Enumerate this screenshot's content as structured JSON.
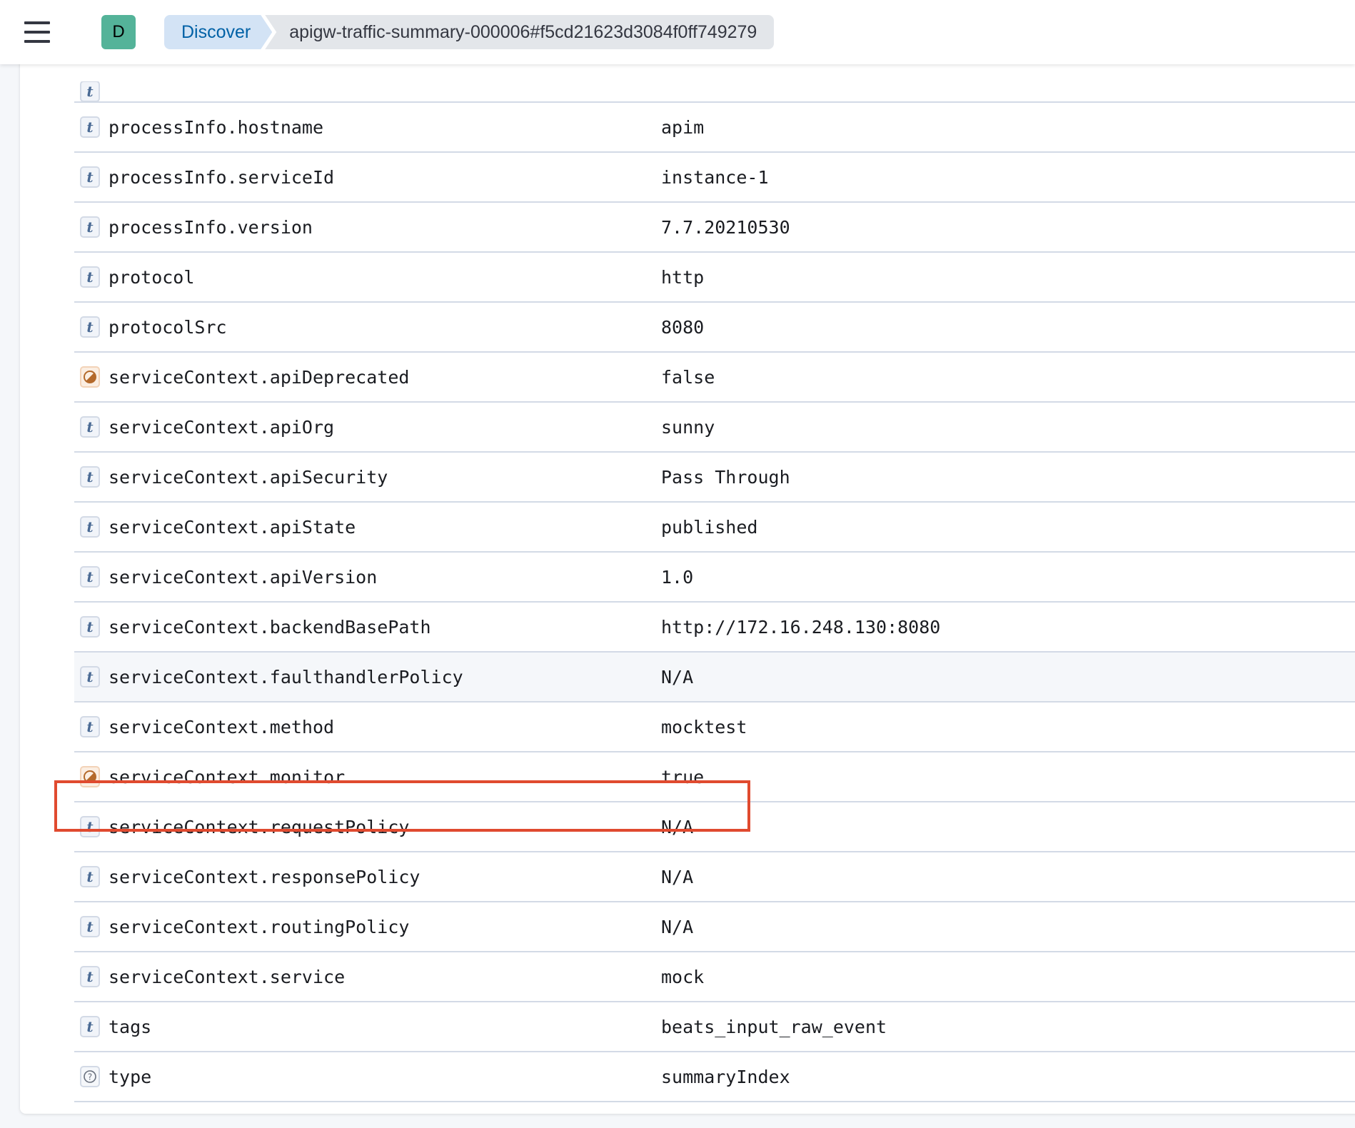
{
  "header": {
    "space_initial": "D",
    "breadcrumbs": [
      {
        "label": "Discover"
      },
      {
        "label": "apigw-traffic-summary-000006#f5cd21623d3084f0ff749279"
      }
    ]
  },
  "colors": {
    "highlight": "#e04a2f",
    "avatar": "#54b399",
    "breadcrumb_link": "#0061a6"
  },
  "rows": [
    {
      "type": "string",
      "icon": "string-type-icon",
      "name": "processInfo.hostname",
      "value": "apim"
    },
    {
      "type": "string",
      "icon": "string-type-icon",
      "name": "processInfo.serviceId",
      "value": "instance-1"
    },
    {
      "type": "string",
      "icon": "string-type-icon",
      "name": "processInfo.version",
      "value": "7.7.20210530"
    },
    {
      "type": "string",
      "icon": "string-type-icon",
      "name": "protocol",
      "value": "http"
    },
    {
      "type": "string",
      "icon": "string-type-icon",
      "name": "protocolSrc",
      "value": "8080"
    },
    {
      "type": "boolean",
      "icon": "boolean-type-icon",
      "name": "serviceContext.apiDeprecated",
      "value": "false"
    },
    {
      "type": "string",
      "icon": "string-type-icon",
      "name": "serviceContext.apiOrg",
      "value": "sunny"
    },
    {
      "type": "string",
      "icon": "string-type-icon",
      "name": "serviceContext.apiSecurity",
      "value": "Pass Through"
    },
    {
      "type": "string",
      "icon": "string-type-icon",
      "name": "serviceContext.apiState",
      "value": "published"
    },
    {
      "type": "string",
      "icon": "string-type-icon",
      "name": "serviceContext.apiVersion",
      "value": "1.0"
    },
    {
      "type": "string",
      "icon": "string-type-icon",
      "name": "serviceContext.backendBasePath",
      "value": "http://172.16.248.130:8080"
    },
    {
      "type": "string",
      "icon": "string-type-icon",
      "name": "serviceContext.faulthandlerPolicy",
      "value": "N/A",
      "hover": true
    },
    {
      "type": "string",
      "icon": "string-type-icon",
      "name": "serviceContext.method",
      "value": "mocktest"
    },
    {
      "type": "boolean",
      "icon": "boolean-type-icon",
      "name": "serviceContext.monitor",
      "value": "true"
    },
    {
      "type": "string",
      "icon": "string-type-icon",
      "name": "serviceContext.requestPolicy",
      "value": "N/A",
      "highlighted": true
    },
    {
      "type": "string",
      "icon": "string-type-icon",
      "name": "serviceContext.responsePolicy",
      "value": "N/A"
    },
    {
      "type": "string",
      "icon": "string-type-icon",
      "name": "serviceContext.routingPolicy",
      "value": "N/A"
    },
    {
      "type": "string",
      "icon": "string-type-icon",
      "name": "serviceContext.service",
      "value": "mock"
    },
    {
      "type": "string",
      "icon": "string-type-icon",
      "name": "tags",
      "value": "beats_input_raw_event"
    },
    {
      "type": "unknown",
      "icon": "unknown-type-icon",
      "name": "type",
      "value": "summaryIndex"
    }
  ]
}
